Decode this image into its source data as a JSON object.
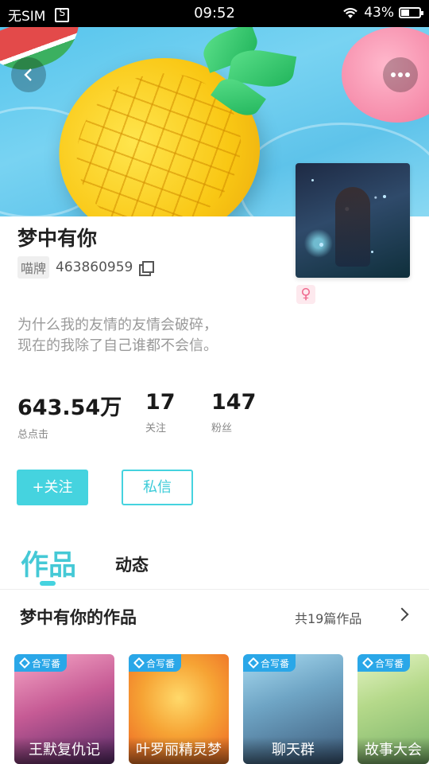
{
  "status_bar": {
    "carrier": "无SIM",
    "time": "09:52",
    "battery": "43%",
    "battery_level": 0.43
  },
  "header": {
    "back_icon": "chevron-left-icon",
    "more_icon": "more-dots-icon"
  },
  "profile": {
    "username": "梦中有你",
    "id_label": "喵牌",
    "id_number": "463860959",
    "gender_symbol": "♀",
    "bio_line1": "为什么我的友情的友情会破碎，",
    "bio_line2": "现在的我除了自己谁都不会信。"
  },
  "stats": [
    {
      "value": "643.54万",
      "label": "总点击"
    },
    {
      "value": "17",
      "label": "关注"
    },
    {
      "value": "147",
      "label": "粉丝"
    }
  ],
  "actions": {
    "follow": "+关注",
    "message": "私信"
  },
  "tabs": {
    "works": "作品",
    "dynamic": "动态"
  },
  "works_section": {
    "title": "梦中有你的作品",
    "count": "共19篇作品",
    "cards": [
      {
        "tag": "合写番",
        "title": "王默复仇记"
      },
      {
        "tag": "合写番",
        "title": "叶罗丽精灵梦"
      },
      {
        "tag": "合写番",
        "title": "聊天群"
      },
      {
        "tag": "合写番",
        "title": "故事大会"
      }
    ]
  },
  "colors": {
    "accent": "#45d3df",
    "tag_blue": "#2aa7e8",
    "status_bar": "#000000"
  }
}
